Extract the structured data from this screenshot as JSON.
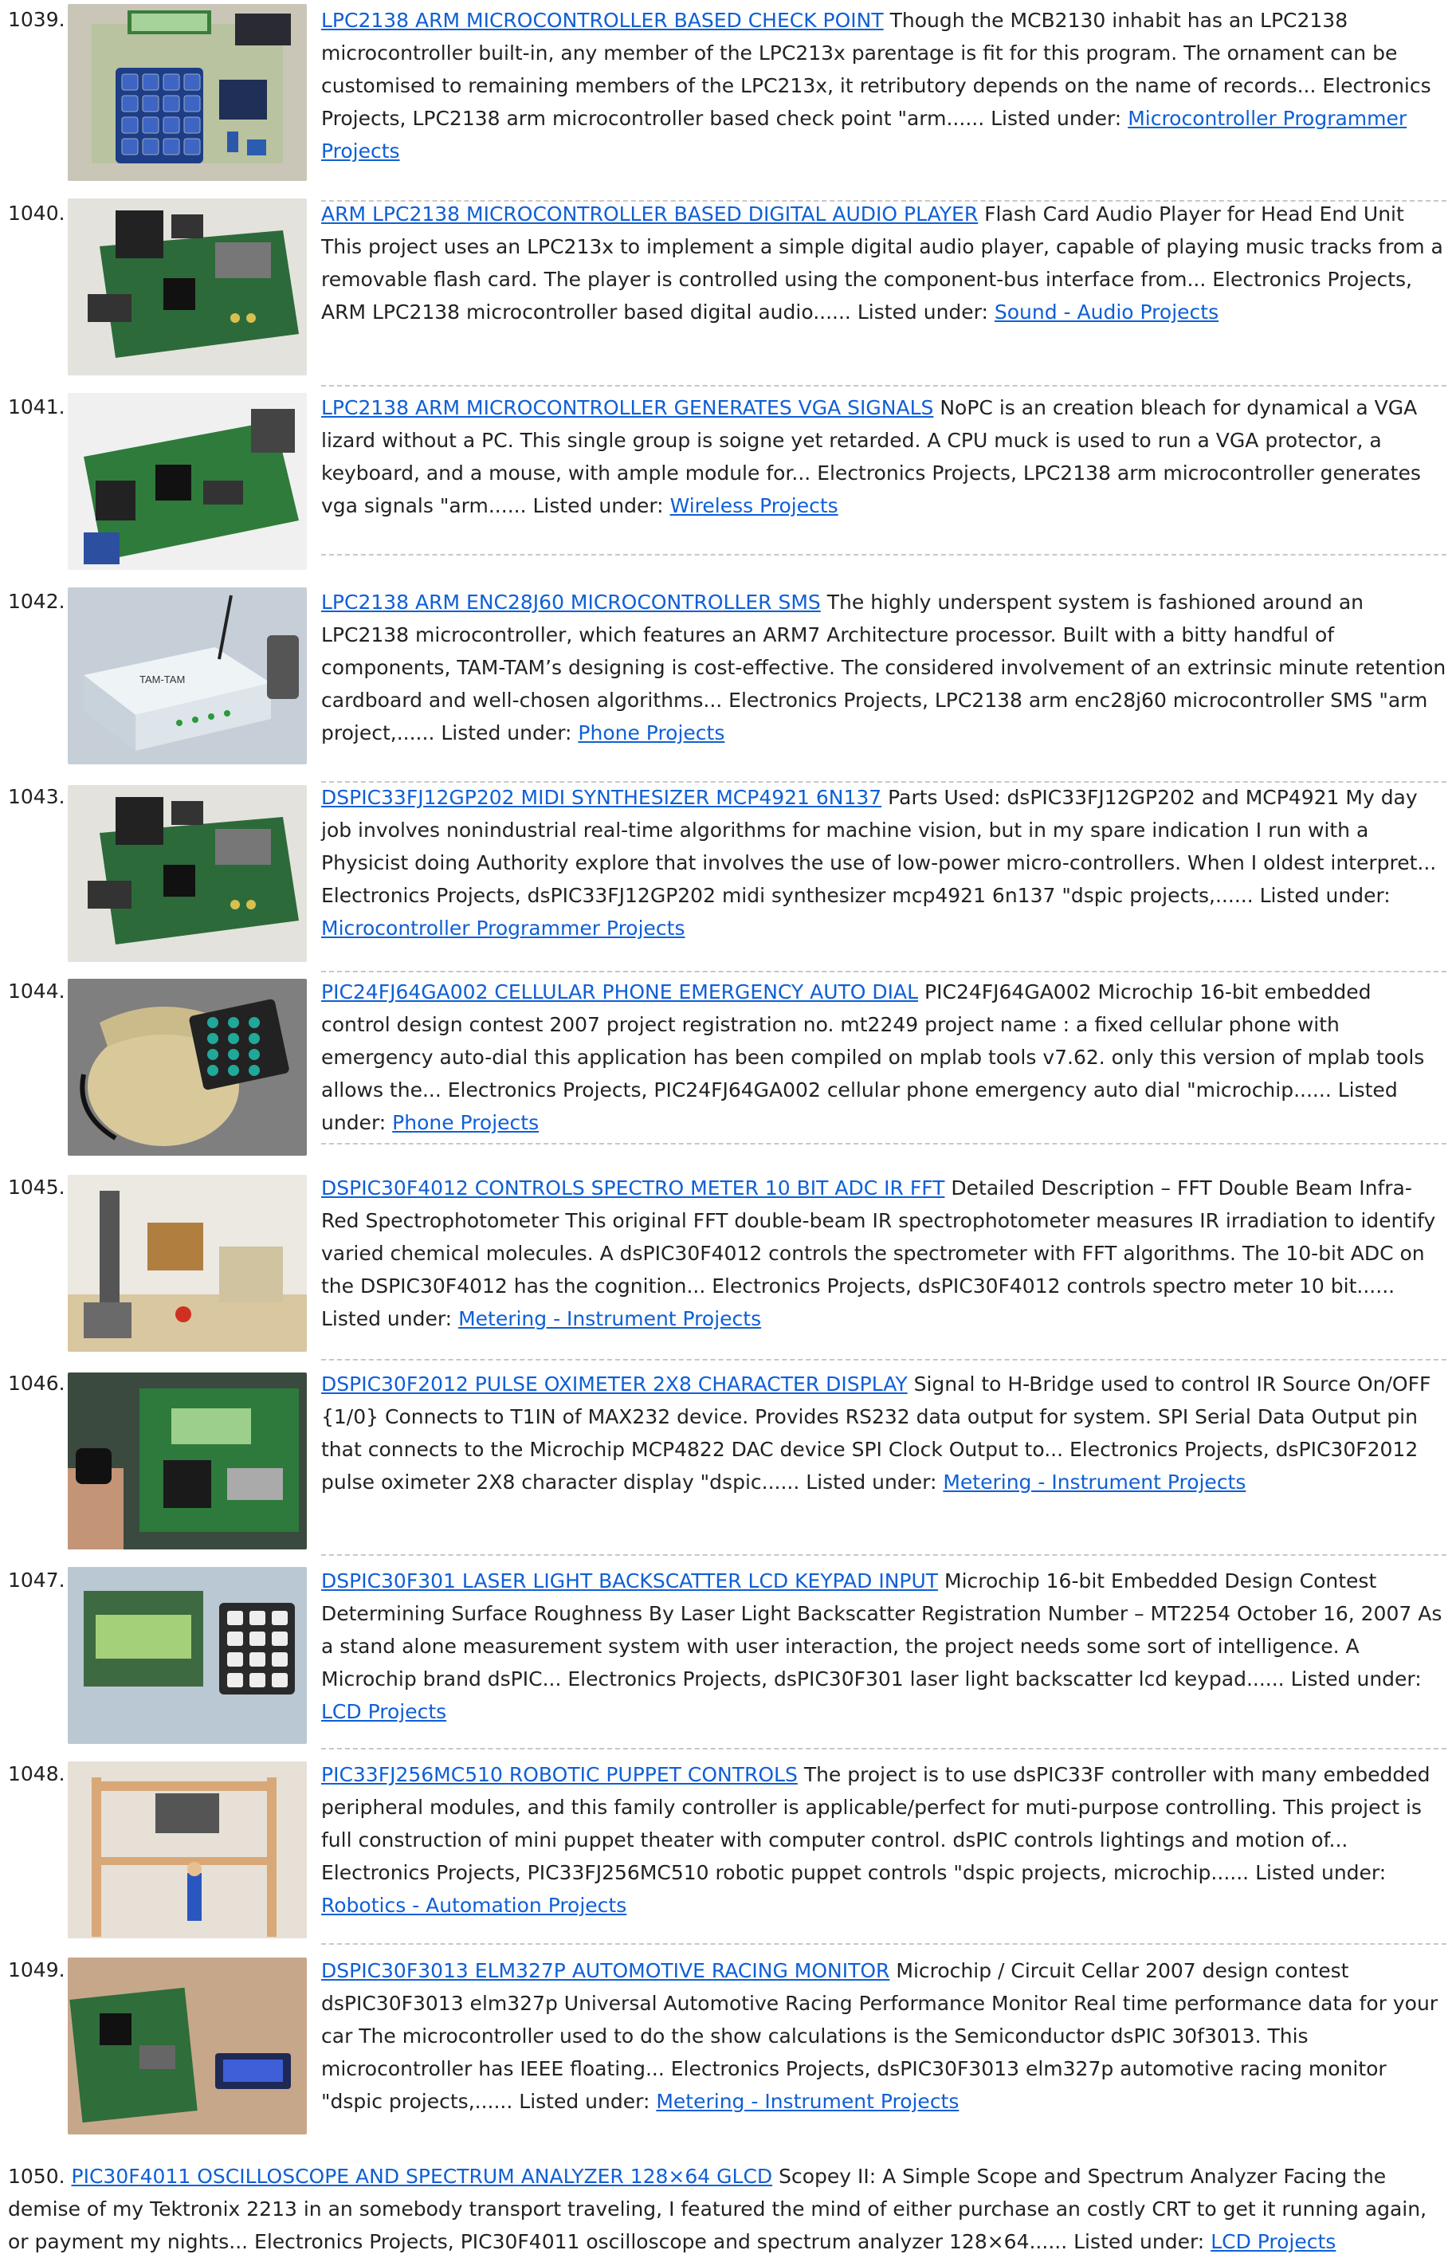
{
  "entries": [
    {
      "number": "1039.",
      "title": "LPC2138 ARM MICROCONTROLLER BASED CHECK POINT",
      "description": "Though the MCB2130 inhabit has an LPC2138 microcontroller built-in, any member of the LPC213x parentage is fit for this program. The ornament can be customised to remaining members of the LPC213x, it retributory depends on the name of records... Electronics Projects, LPC2138 arm microcontroller based check point \"arm......",
      "listed_label": "Listed under:",
      "category": "Microcontroller Programmer Projects",
      "thumb": "keypad-board"
    },
    {
      "number": "1040.",
      "title": "ARM LPC2138 MICROCONTROLLER BASED DIGITAL AUDIO PLAYER",
      "description": "Flash Card Audio Player for Head End Unit This project uses an LPC213x to implement a simple digital audio player, capable of playing music tracks from a removable flash card. The player is controlled using the component-bus interface from... Electronics Projects, ARM LPC2138 microcontroller based digital audio......",
      "listed_label": "Listed under:",
      "category": "Sound - Audio Projects",
      "thumb": "green-board"
    },
    {
      "number": "1041.",
      "title": "LPC2138 ARM MICROCONTROLLER GENERATES VGA SIGNALS",
      "description": "NoPC is an creation bleach for dynamical a VGA lizard without a PC. This single group is soigne yet retarded. A CPU muck is used to run a VGA protector, a keyboard, and a mouse, with ample module for... Electronics Projects, LPC2138 arm microcontroller generates vga signals \"arm......",
      "listed_label": "Listed under:",
      "category": "Wireless Projects",
      "thumb": "green-board-2"
    },
    {
      "number": "1042.",
      "title": "LPC2138 ARM ENC28J60 MICROCONTROLLER SMS",
      "description": "The highly underspent system is fashioned around an LPC2138 microcontroller, which features an ARM7 Architecture processor. Built with a bitty handful of components, TAM-TAM’s designing is cost-effective. The considered involvement of an extrinsic minute retention cardboard and well-chosen algorithms... Electronics Projects, LPC2138 arm enc28j60 microcontroller SMS \"arm project,......",
      "listed_label": "Listed under:",
      "category": "Phone Projects",
      "thumb": "box",
      "box_label": "TAM-TAM"
    },
    {
      "number": "1043.",
      "title": "DSPIC33FJ12GP202 MIDI SYNTHESIZER MCP4921 6N137",
      "description": "Parts Used: dsPIC33FJ12GP202 and MCP4921 My day job involves nonindustrial real-time algorithms for machine vision, but in my spare indication I run with a Physicist doing Authority explore that involves the use of low-power micro-controllers. When I oldest interpret... Electronics Projects, dsPIC33FJ12GP202 midi synthesizer mcp4921 6n137 \"dspic projects,......",
      "listed_label": "Listed under:",
      "category": "Microcontroller Programmer Projects",
      "thumb": "green-board"
    },
    {
      "number": "1044.",
      "title": "PIC24FJ64GA002 CELLULAR PHONE EMERGENCY AUTO DIAL",
      "description": "PIC24FJ64GA002 Microchip 16-bit embedded control design contest 2007 project registration no. mt2249 project name : a fixed cellular phone with emergency auto-dial this application has been compiled on mplab tools v7.62. only this version of mplab tools allows the... Electronics Projects, PIC24FJ64GA002 cellular phone emergency auto dial \"microchip......",
      "listed_label": "Listed under:",
      "category": "Phone Projects",
      "thumb": "phone"
    },
    {
      "number": "1045.",
      "title": "DSPIC30F4012 CONTROLS SPECTRO METER 10 BIT ADC IR FFT",
      "description": "Detailed Description – FFT Double Beam Infra-Red Spectrophotometer This original FFT double-beam IR spectrophotometer measures IR irradiation to identify varied chemical molecules. A dsPIC30F4012 controls the spectrometer with FFT algorithms. The 10-bit ADC on the DSPIC30F4012 has the cognition... Electronics Projects, dsPIC30F4012 controls spectro meter 10 bit......",
      "listed_label": "Listed under:",
      "category": "Metering - Instrument Projects",
      "thumb": "lab"
    },
    {
      "number": "1046.",
      "title": "DSPIC30F2012 PULSE OXIMETER 2X8 CHARACTER DISPLAY",
      "description": "Signal to H-Bridge used to control IR Source On/OFF {1/0} Connects to T1IN of MAX232 device. Provides RS232 data output for system. SPI Serial Data Output pin that connects to the Microchip MCP4822 DAC device SPI Clock Output to... Electronics Projects, dsPIC30F2012 pulse oximeter 2X8 character display \"dspic......",
      "listed_label": "Listed under:",
      "category": "Metering - Instrument Projects",
      "thumb": "oximeter"
    },
    {
      "number": "1047.",
      "title": "DSPIC30F301 LASER LIGHT BACKSCATTER LCD KEYPAD INPUT",
      "description": "Microchip 16-bit Embedded Design Contest Determining Surface Roughness By Laser Light Backscatter Registration Number – MT2254 October 16, 2007 As a stand alone measurement system with user interaction, the project needs some sort of intelligence. A Microchip brand dsPIC... Electronics Projects, dsPIC30F301 laser light backscatter lcd keypad......",
      "listed_label": "Listed under:",
      "category": "LCD Projects",
      "thumb": "lcd-keypad"
    },
    {
      "number": "1048.",
      "title": "PIC33FJ256MC510 ROBOTIC PUPPET CONTROLS",
      "description": "The project is to use dsPIC33F controller with many embedded peripheral modules, and this family controller is applicable/perfect for muti-purpose controlling. This project is full construction of mini puppet theater with computer control. dsPIC controls lightings and motion of... Electronics Projects, PIC33FJ256MC510 robotic puppet controls \"dspic projects, microchip......",
      "listed_label": "Listed under:",
      "category": "Robotics - Automation Projects",
      "thumb": "puppet"
    },
    {
      "number": "1049.",
      "title": "DSPIC30F3013 ELM327P AUTOMOTIVE RACING MONITOR",
      "description": "Microchip / Circuit Cellar 2007 design contest dsPIC30F3013 elm327p Universal Automotive Racing Performance Monitor Real time performance data for your car The microcontroller used to do the show calculations is the Semiconductor dsPIC 30f3013. This microcontroller has IEEE floating... Electronics Projects, dsPIC30F3013 elm327p automotive racing monitor \"dspic projects,......",
      "listed_label": "Listed under:",
      "category": "Metering - Instrument Projects",
      "thumb": "racing"
    }
  ],
  "last_entry": {
    "number": "1050.",
    "title": "PIC30F4011 OSCILLOSCOPE AND SPECTRUM ANALYZER 128×64 GLCD",
    "description": "Scopey II: A Simple Scope and Spectrum Analyzer Facing the demise of my Tektronix 2213 in an somebody transport traveling, I featured the mind of either purchase an costly CRT to get it running again, or payment my nights... Electronics Projects, PIC30F4011 oscilloscope and spectrum analyzer 128×64......",
    "listed_label": "Listed under:",
    "category": "LCD Projects"
  },
  "colors": {
    "link": "#0f5fd6",
    "text": "#222222",
    "separator": "#c8c8c8"
  }
}
